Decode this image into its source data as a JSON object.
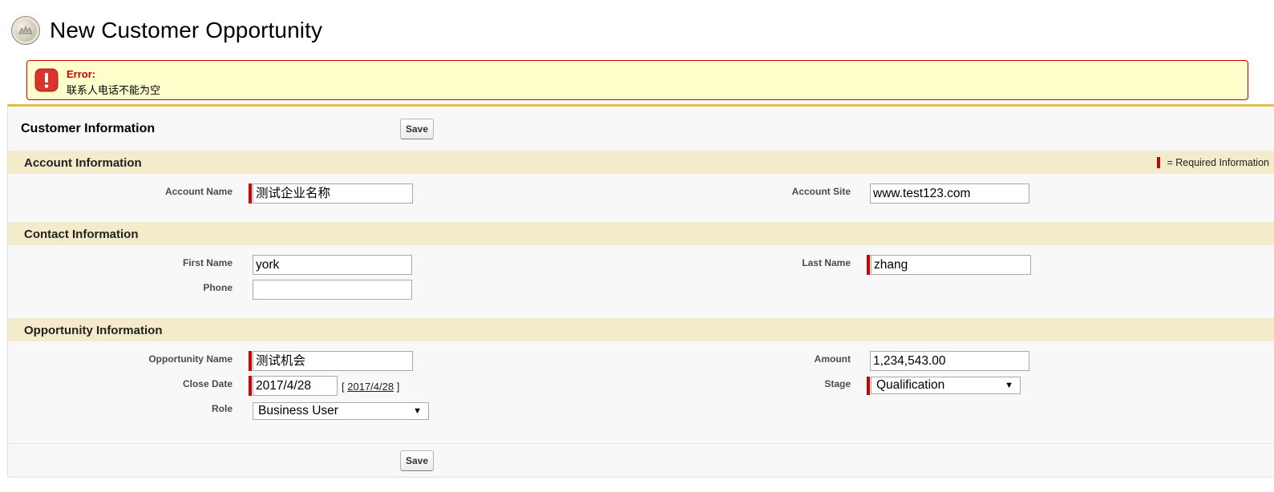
{
  "page": {
    "title": "New Customer Opportunity"
  },
  "error": {
    "title": "Error:",
    "message": "联系人电话不能为空"
  },
  "form": {
    "title": "Customer Information",
    "save_label": "Save",
    "required_legend": "= Required Information",
    "sections": {
      "account": {
        "title": "Account Information",
        "account_name": {
          "label": "Account Name",
          "value": "测试企业名称"
        },
        "account_site": {
          "label": "Account Site",
          "value": "www.test123.com"
        }
      },
      "contact": {
        "title": "Contact Information",
        "first_name": {
          "label": "First Name",
          "value": "york"
        },
        "last_name": {
          "label": "Last Name",
          "value": "zhang"
        },
        "phone": {
          "label": "Phone",
          "value": ""
        }
      },
      "opportunity": {
        "title": "Opportunity Information",
        "opportunity_name": {
          "label": "Opportunity Name",
          "value": "测试机会"
        },
        "amount": {
          "label": "Amount",
          "value": "1,234,543.00"
        },
        "close_date": {
          "label": "Close Date",
          "value": "2017/4/28",
          "today_link": "2017/4/28",
          "bracket_open": "[",
          "bracket_close": "]"
        },
        "stage": {
          "label": "Stage",
          "value": "Qualification"
        },
        "role": {
          "label": "Role",
          "value": "Business User"
        }
      }
    }
  },
  "colors": {
    "required": "#cc0000",
    "section_bar": "#f3ebc9",
    "accent": "#e1be3e",
    "error_bg": "#ffffcc"
  },
  "icons": {
    "page": "opportunity-coin-icon",
    "error": "error-exclamation-icon",
    "select": "dropdown-arrow-icon"
  }
}
